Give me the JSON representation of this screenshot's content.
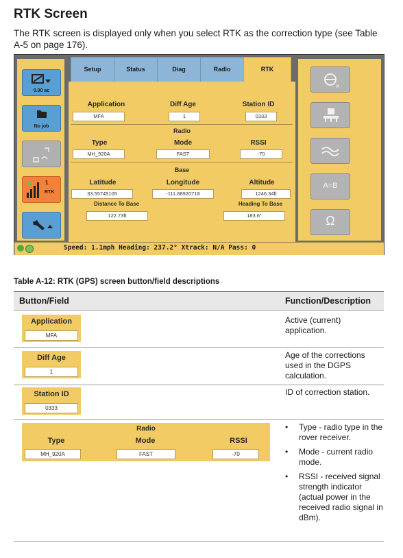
{
  "heading": "RTK Screen",
  "intro": "The RTK screen is displayed only when you select RTK as the correction type (see Table A-5 on page 176).",
  "screen": {
    "tabs": [
      "Setup",
      "Status",
      "Diag",
      "Radio",
      "RTK"
    ],
    "active_tab": "RTK",
    "left_buttons": [
      {
        "label": "0.00 ac",
        "icon": "area-icon"
      },
      {
        "label": "No job",
        "icon": "folder-icon"
      },
      {
        "label": "",
        "icon": "boundary-icon"
      },
      {
        "label": "RTK",
        "icon": "signal-bars-icon",
        "badge": "1"
      },
      {
        "label": "",
        "icon": "wrench-icon"
      }
    ],
    "right_buttons": [
      "steering-icon",
      "implement-icon",
      "wave-icon",
      "ab-line-icon",
      "omega-icon"
    ],
    "right_ab_text": "A=B",
    "application_label": "Application",
    "application_value": "MFA",
    "diff_age_label": "Diff Age",
    "diff_age_value": "1",
    "station_id_label": "Station ID",
    "station_id_value": "0333",
    "radio_heading": "Radio",
    "type_label": "Type",
    "type_value": "MH_920A",
    "mode_label": "Mode",
    "mode_value": "FAST",
    "rssi_label": "RSSI",
    "rssi_value": "-70",
    "base_heading": "Base",
    "latitude_label": "Latitude",
    "latitude_value": "33.55745105",
    "longitude_label": "Longitude",
    "longitude_value": "-111.88920718",
    "altitude_label": "Altitude",
    "altitude_value": "1246.34ft",
    "distance_label": "Distance To Base",
    "distance_value": "122.73ft",
    "heading_base_label": "Heading To Base",
    "heading_base_value": "183.6°",
    "status_bar": "Speed: 1.1mph  Heading: 237.2°  Xtrack: N/A  Pass:  0"
  },
  "table": {
    "caption": "Table A-12:  RTK (GPS) screen button/field descriptions",
    "col1": "Button/Field",
    "col2": "Function/Description",
    "rows": [
      {
        "field": "Application",
        "value": "MFA",
        "desc": "Active (current) application."
      },
      {
        "field": "Diff Age",
        "value": "1",
        "desc": "Age of the corrections used in the DGPS calculation."
      },
      {
        "field": "Station ID",
        "value": "0333",
        "desc": "ID of correction station."
      }
    ],
    "radio_row": {
      "heading": "Radio",
      "type_label": "Type",
      "type_value": "MH_920A",
      "mode_label": "Mode",
      "mode_value": "FAST",
      "rssi_label": "RSSI",
      "rssi_value": "-70",
      "bullets": [
        "Type - radio type in the rover receiver.",
        "Mode - current radio mode.",
        "RSSI - received signal strength indicator (actual power in the received radio signal in dBm)."
      ]
    }
  },
  "colors": {
    "panel_yellow": "#f2cb64",
    "tab_blue": "#8db5d8",
    "button_blue": "#5a9fd4",
    "button_orange": "#f2813a",
    "button_gray": "#b0b0b0"
  }
}
